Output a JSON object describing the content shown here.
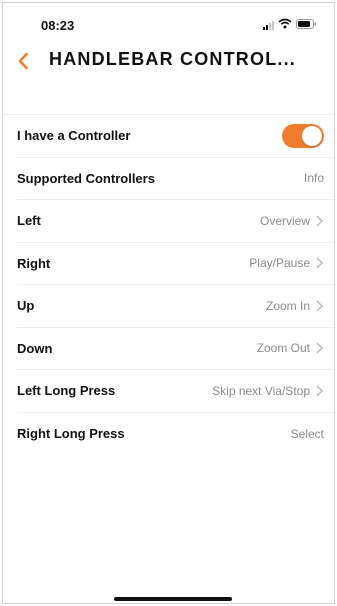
{
  "status_bar": {
    "time": "08:23",
    "icons": [
      "signal-icon",
      "wifi-icon",
      "battery-icon"
    ]
  },
  "header": {
    "back_icon": "chevron-left-icon",
    "title": "HANDLEBAR CONTROL..."
  },
  "colors": {
    "accent": "#f07d2e",
    "label": "#111111",
    "value": "#8a8a8e",
    "separator": "#ededed"
  },
  "settings": {
    "have_controller": {
      "label": "I have a Controller",
      "enabled": true
    },
    "supported": {
      "label": "Supported Controllers",
      "value": "Info"
    },
    "left": {
      "label": "Left",
      "value": "Overview"
    },
    "right": {
      "label": "Right",
      "value": "Play/Pause"
    },
    "up": {
      "label": "Up",
      "value": "Zoom In"
    },
    "down": {
      "label": "Down",
      "value": "Zoom Out"
    },
    "left_long": {
      "label": "Left Long Press",
      "value": "Skip next Via/Stop"
    },
    "right_long": {
      "label": "Right Long Press",
      "value": "Select"
    }
  }
}
